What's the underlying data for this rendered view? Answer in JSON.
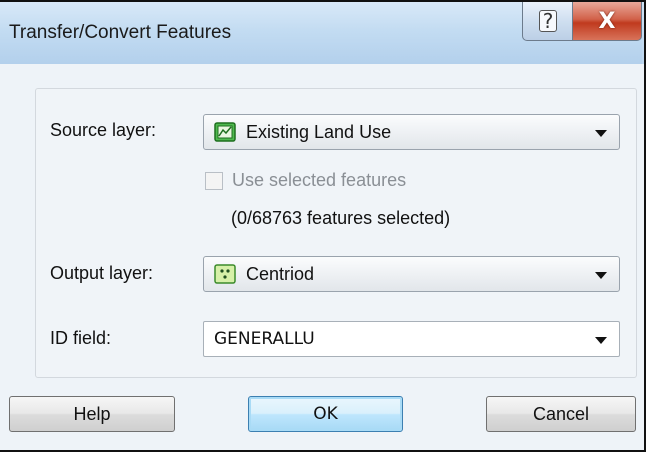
{
  "window": {
    "title": "Transfer/Convert Features",
    "help_button": "?",
    "close_button": "X"
  },
  "source_layer": {
    "label": "Source layer:",
    "value": "Existing Land Use",
    "icon": "polygon-layer-icon"
  },
  "use_selected": {
    "label": "Use selected features",
    "checked": false,
    "enabled": false
  },
  "selection_count": "(0/68763 features selected)",
  "output_layer": {
    "label": "Output layer:",
    "value": "Centriod",
    "icon": "point-layer-icon"
  },
  "id_field": {
    "label": "ID field:",
    "value": "GENERALLU"
  },
  "buttons": {
    "help": "Help",
    "ok": "OK",
    "cancel": "Cancel"
  },
  "colors": {
    "title_bar": "#c3dcf2",
    "close_button": "#c03a1e",
    "default_button": "#bee6fd",
    "layer_icon_green": "#3aa83a",
    "point_icon_fill": "#d6f0a8"
  }
}
